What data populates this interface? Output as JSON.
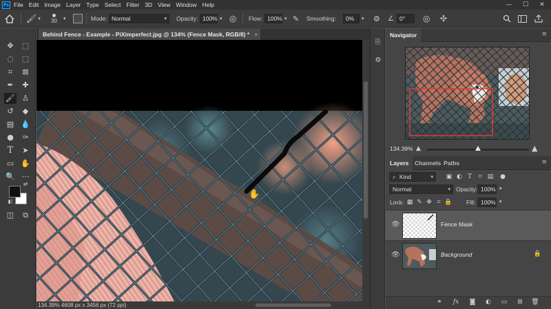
{
  "app": {
    "logo_text": "Ps"
  },
  "menu": [
    "File",
    "Edit",
    "Image",
    "Layer",
    "Type",
    "Select",
    "Filter",
    "3D",
    "View",
    "Window",
    "Help"
  ],
  "window_controls": {
    "minimize": "—",
    "maximize": "☐",
    "close": "✕"
  },
  "options": {
    "brush_size": "30",
    "mode_label": "Mode:",
    "mode_value": "Normal",
    "opacity_label": "Opacity:",
    "opacity_value": "100%",
    "flow_label": "Flow:",
    "flow_value": "100%",
    "smoothing_label": "Smoothing:",
    "smoothing_value": "0%",
    "angle_value": "0°"
  },
  "document": {
    "tab_title": "Behind Fence - Example - PiXimperfect.jpg @ 134% (Fence Mask, RGB/8) *",
    "tab_close": "×",
    "status_text": "134.39%   4608 px x 3456 px (72 ppi)"
  },
  "navigator": {
    "tab_label": "Navigator",
    "zoom": "134.39%",
    "zoom_fraction": 0.5
  },
  "layers_panel": {
    "tabs": [
      "Layers",
      "Channels",
      "Paths"
    ],
    "filter_label": "Kind",
    "blend_mode": "Normal",
    "opacity_label": "Opacity:",
    "opacity_value": "100%",
    "lock_label": "Lock:",
    "fill_label": "Fill:",
    "fill_value": "100%",
    "layers": [
      {
        "name": "Fence Mask",
        "selected": true,
        "italic": false
      },
      {
        "name": "Background",
        "selected": false,
        "italic": true,
        "locked": true
      }
    ]
  },
  "colors": {
    "accent": "#31a8ff",
    "foreground": "#111111",
    "background_swatch": "#ffffff"
  }
}
